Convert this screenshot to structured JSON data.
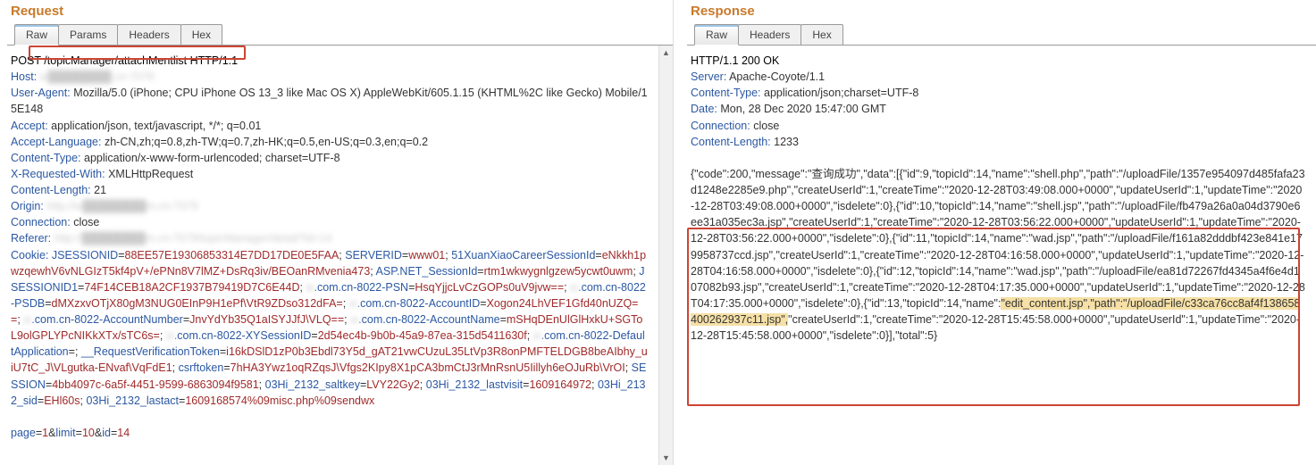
{
  "request": {
    "title": "Request",
    "tabs": [
      {
        "label": "Raw",
        "active": true
      },
      {
        "label": "Params",
        "active": false
      },
      {
        "label": "Headers",
        "active": false
      },
      {
        "label": "Hex",
        "active": false
      }
    ],
    "method": "POST",
    "path": "/topicManager/attachMentlist",
    "httpver": "HTTP/1.1",
    "headers": {
      "host_label": "Host:",
      "host_blur": "w████████.cn:7079",
      "ua_label": "User-Agent:",
      "ua": "Mozilla/5.0 (iPhone; CPU iPhone OS 13_3 like Mac OS X) AppleWebKit/605.1.15 (KHTML%2C like Gecko) Mobile/15E148",
      "accept_label": "Accept:",
      "accept": "application/json, text/javascript, */*; q=0.01",
      "al_label": "Accept-Language:",
      "al": "zh-CN,zh;q=0.8,zh-TW;q=0.7,zh-HK;q=0.5,en-US;q=0.3,en;q=0.2",
      "ct_label": "Content-Type:",
      "ct": "application/x-www-form-urlencoded; charset=UTF-8",
      "xrw_label": "X-Requested-With:",
      "xrw": "XMLHttpRequest",
      "cl_label": "Content-Length:",
      "cl": "21",
      "origin_label": "Origin:",
      "origin_blur": "http://w████████m.cn:7079",
      "conn_label": "Connection:",
      "conn": "close",
      "referer_label": "Referer:",
      "referer_blur": "http://████████m.cn:7079/topicManager/detail?id=14",
      "cookie_label": "Cookie:"
    },
    "cookies": [
      {
        "k": "JSESSIONID",
        "v": "88EE57E19306853314E7DD17DE0E5FAA"
      },
      {
        "k": "SERVERID",
        "v": "www01"
      },
      {
        "k": "51XuanXiaoCareerSessionId",
        "v": "eNkkh1pwzqewhV6vNLGIzT5kf4pV+/ePNn8V7lMZ+DsRq3iv/BEOanRMvenia473"
      },
      {
        "k": "ASP.NET_SessionId",
        "v": "rtm1wkwygnlgzew5ycwt0uwm"
      },
      {
        "k": "JSESSIONID1",
        "v": "74F14CEB18A2CF1937B79419D7C6E44D"
      },
      {
        "k": "w███.com.cn-8022-PSN",
        "v": "HsqYjjcLvCzGOPs0uV9jvw=="
      },
      {
        "k": "w███.com.cn-8022-PSDB",
        "v": "dMXzxvOTjX80gM3NUG0EInP9H1ePf\\VtR9ZDso312dFA="
      },
      {
        "k": "w███.com.cn-8022-AccountID",
        "v": "Xogon24LhVEF1Gfd40nUZQ=="
      },
      {
        "k": "w███.com.cn-8022-AccountNumber",
        "v": "JnvYdYb35Q1aISYJJfJ\\VLQ=="
      },
      {
        "k": "w███.com.cn-8022-AccountName",
        "v": "mSHqDEnUlGlHxkU+SGToL9olGPLYPcNIKkXTx/sTC6s="
      },
      {
        "k": "w███.com.cn-8022-XYSessionID",
        "v": "2d54ec4b-9b0b-45a9-87ea-315d5411630f"
      },
      {
        "k": "w███.com.cn-8022-DefaultApplication",
        "v": ""
      },
      {
        "k": "__RequestVerificationToken",
        "v": "i16kDSlD1zP0b3Ebdl73Y5d_gAT21vwCUzuL35LtVp3R8onPMFTELDGB8beAIbhy_uiU7tC_J\\VLgutka-ENvaf\\VqFdE1"
      },
      {
        "k": "csrftoken",
        "v": "7hHA3Ywz1oqRZqsJ\\Vfgs2KIpy8X1pCA3bmCtJ3rMnRsnU5Iillyh6eOJuRb\\VrOI"
      },
      {
        "k": "SESSION",
        "v": "4bb4097c-6a5f-4451-9599-6863094f9581"
      },
      {
        "k": "03Hi_2132_saltkey",
        "v": "LVY22Gy2"
      },
      {
        "k": "03Hi_2132_lastvisit",
        "v": "1609164972"
      },
      {
        "k": "03Hi_2132_sid",
        "v": "EHl60s"
      },
      {
        "k": "03Hi_2132_lastact",
        "v": "1609168574%09misc.php%09sendwx"
      }
    ],
    "body_parts": [
      {
        "k": "page",
        "v": "1"
      },
      {
        "k": "limit",
        "v": "10"
      },
      {
        "k": "id",
        "v": "14"
      }
    ]
  },
  "response": {
    "title": "Response",
    "tabs": [
      {
        "label": "Raw",
        "active": true
      },
      {
        "label": "Headers",
        "active": false
      },
      {
        "label": "Hex",
        "active": false
      }
    ],
    "status_line": "HTTP/1.1 200 OK",
    "headers": {
      "server_label": "Server:",
      "server": "Apache-Coyote/1.1",
      "ct_label": "Content-Type:",
      "ct": "application/json;charset=UTF-8",
      "date_label": "Date:",
      "date": "Mon, 28 Dec 2020 15:47:00 GMT",
      "conn_label": "Connection:",
      "conn": "close",
      "cl_label": "Content-Length:",
      "cl": "1233"
    },
    "body_pre": "{\"code\":200,\"message\":\"查询成功\",\"data\":[{\"id\":9,\"topicId\":14,\"name\":\"shell.php\",\"path\":\"/uploadFile/1357e954097d485fafa23d1248e2285e9.php\",\"createUserId\":1,\"createTime\":\"2020-12-28T03:49:08.000+0000\",\"updateUserId\":1,\"updateTime\":\"2020-12-28T03:49:08.000+0000\",\"isdelete\":0},{\"id\":10,\"topicId\":14,\"name\":\"shell.jsp\",\"path\":\"/uploadFile/fb479a26a0a04d3790e6ee31a035ec3a.jsp\",\"createUserId\":1,\"createTime\":\"2020-12-28T03:56:22.000+0000\",\"updateUserId\":1,\"updateTime\":\"2020-12-28T03:56:22.000+0000\",\"isdelete\":0},{\"id\":11,\"topicId\":14,\"name\":\"wad.jsp\",\"path\":\"/uploadFile/f161a82dddbf423e841e179958737ccd.jsp\",\"createUserId\":1,\"createTime\":\"2020-12-28T04:16:58.000+0000\",\"updateUserId\":1,\"updateTime\":\"2020-12-28T04:16:58.000+0000\",\"isdelete\":0},{\"id\":12,\"topicId\":14,\"name\":\"wad.jsp\",\"path\":\"/uploadFile/ea81d72267fd4345a4f6e4d107082b93.jsp\",\"createUserId\":1,\"createTime\":\"2020-12-28T04:17:35.000+0000\",\"updateUserId\":1,\"updateTime\":\"2020-12-28T04:17:35.000+0000\",\"isdelete\":0},{\"id\":13,\"topicId\":14,\"name\":",
    "body_hl": "\"edit_content.jsp\",\"path\":\"/uploadFile/c33ca76cc8af4f138658400262937c11.jsp\",",
    "body_post": "\"createUserId\":1,\"createTime\":\"2020-12-28T15:45:58.000+0000\",\"updateUserId\":1,\"updateTime\":\"2020-12-28T15:45:58.000+0000\",\"isdelete\":0}],\"total\":5}"
  }
}
